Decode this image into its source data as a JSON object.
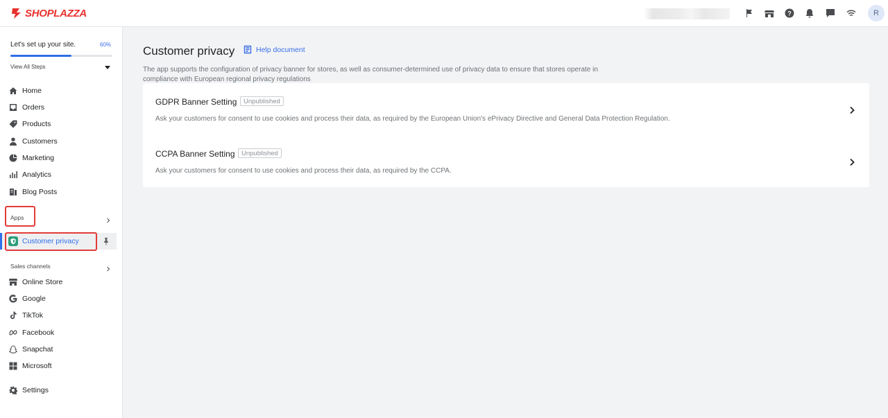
{
  "brand": {
    "name": "SHOPLAZZA",
    "color": "#e8322f"
  },
  "topbar": {
    "icons": [
      "flag-icon",
      "store-icon",
      "help-icon",
      "bell-icon",
      "message-icon",
      "wifi-icon"
    ],
    "avatar_initial": "R"
  },
  "setup": {
    "title": "Let's set up your site.",
    "percent_label": "60%",
    "progress": 0.6,
    "view_steps": "View All Steps"
  },
  "nav": {
    "items": [
      {
        "label": "Home",
        "icon": "home-icon"
      },
      {
        "label": "Orders",
        "icon": "orders-icon"
      },
      {
        "label": "Products",
        "icon": "tag-icon"
      },
      {
        "label": "Customers",
        "icon": "person-icon"
      },
      {
        "label": "Marketing",
        "icon": "marketing-icon"
      },
      {
        "label": "Analytics",
        "icon": "analytics-icon"
      },
      {
        "label": "Blog Posts",
        "icon": "blog-icon"
      }
    ],
    "apps_label": "Apps",
    "active_app": "Customer privacy",
    "sales_channels_label": "Sales channels",
    "channels": [
      {
        "label": "Online Store",
        "icon": "store-icon"
      },
      {
        "label": "Google",
        "icon": "google-icon"
      },
      {
        "label": "TikTok",
        "icon": "tiktok-icon"
      },
      {
        "label": "Facebook",
        "icon": "meta-icon"
      },
      {
        "label": "Snapchat",
        "icon": "snapchat-icon"
      },
      {
        "label": "Microsoft",
        "icon": "microsoft-icon"
      }
    ],
    "settings_label": "Settings"
  },
  "page": {
    "title": "Customer privacy",
    "help_link": "Help document",
    "description": "The app supports the configuration of privacy banner for stores, as well as consumer-determined use of privacy data to ensure that stores operate in compliance with European regional privacy regulations"
  },
  "settings": [
    {
      "title": "GDPR Banner Setting",
      "status": "Unpublished",
      "description": "Ask your customers for consent to use cookies and process their data, as required by the European Union's ePrivacy Directive and General Data Protection Regulation."
    },
    {
      "title": "CCPA Banner Setting",
      "status": "Unpublished",
      "description": "Ask your customers for consent to use cookies and process their data, as required by the CCPA."
    }
  ],
  "colors": {
    "accent": "#2f6fe8",
    "highlight_box": "#e23b36",
    "privacy_icon": "#2a9d7a"
  }
}
